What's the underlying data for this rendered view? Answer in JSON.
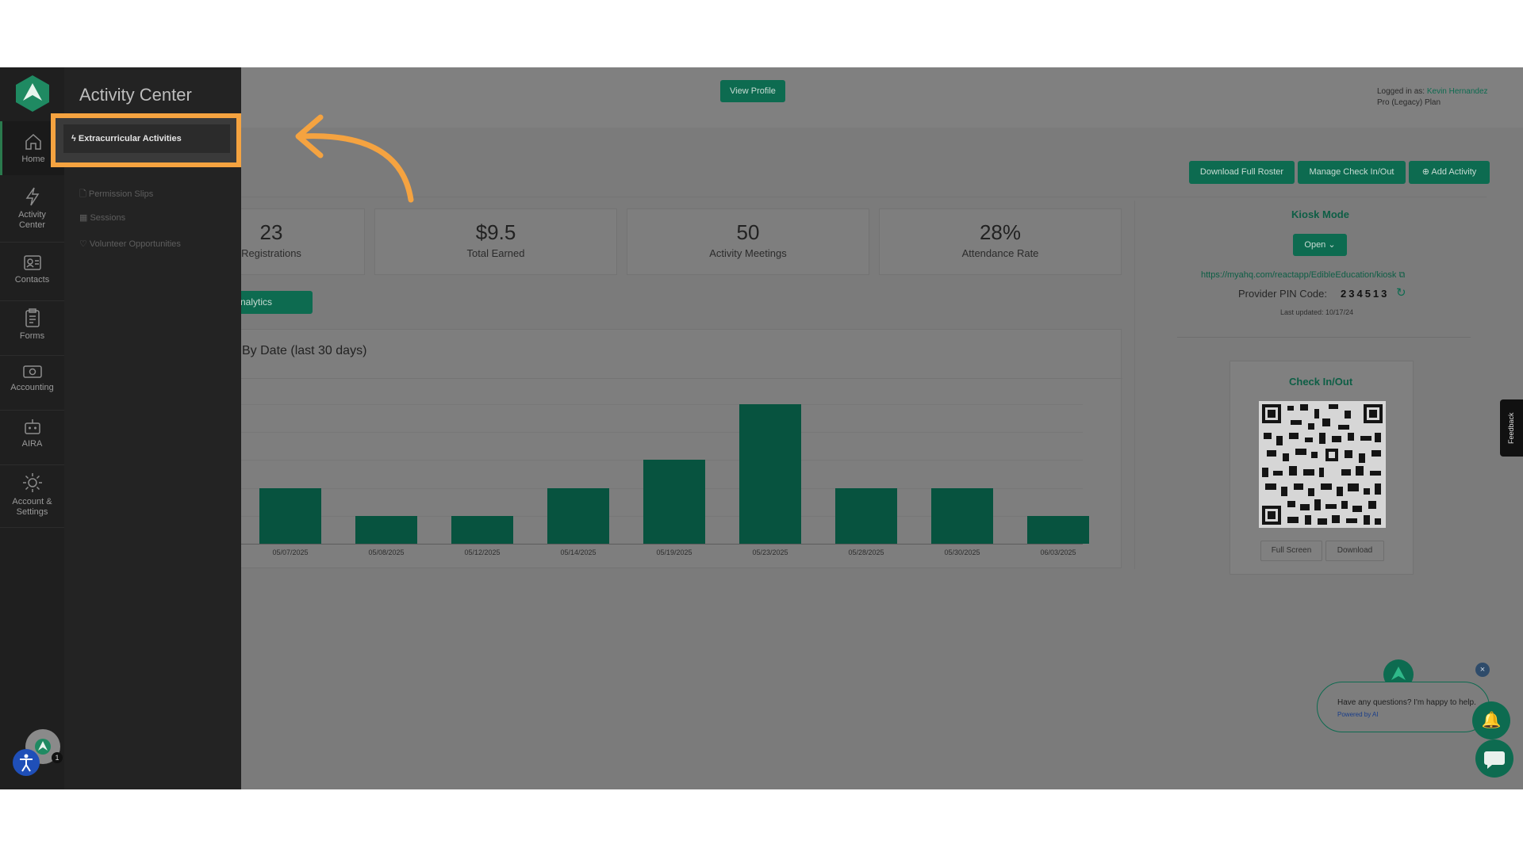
{
  "nav": {
    "items": [
      {
        "label": "Home",
        "icon": "home-icon"
      },
      {
        "label": "Activity Center",
        "icon": "lightning-icon"
      },
      {
        "label": "Contacts",
        "icon": "contacts-icon"
      },
      {
        "label": "Forms",
        "icon": "clipboard-icon"
      },
      {
        "label": "Accounting",
        "icon": "cash-icon"
      },
      {
        "label": "AIRA",
        "icon": "robot-icon"
      },
      {
        "label": "Account & Settings",
        "icon": "gear-icon"
      }
    ],
    "notification_count": "1"
  },
  "panel": {
    "title": "Activity Center",
    "active_item": "Extracurricular Activities",
    "items": [
      "Permission Slips",
      "Sessions",
      "Volunteer Opportunities"
    ]
  },
  "header": {
    "view_profile": "View Profile",
    "logged_in_prefix": "Logged in as:",
    "user_name": "Kevin Hernandez",
    "plan": "Pro (Legacy) Plan"
  },
  "actions": {
    "download_roster": "Download Full Roster",
    "manage_checkin": "Manage Check In/Out",
    "add_activity": "Add Activity"
  },
  "stats": [
    {
      "value": "23",
      "label": "Registrations"
    },
    {
      "value": "$9.5",
      "label": "Total Earned"
    },
    {
      "value": "50",
      "label": "Activity Meetings"
    },
    {
      "value": "28%",
      "label": "Attendance Rate"
    }
  ],
  "analytics_button": "Analytics",
  "chart": {
    "title": "By Date (last 30 days)"
  },
  "chart_data": {
    "type": "bar",
    "title": "By Date (last 30 days)",
    "categories": [
      "05/07/2025",
      "05/08/2025",
      "05/12/2025",
      "05/14/2025",
      "05/19/2025",
      "05/23/2025",
      "05/28/2025",
      "05/30/2025",
      "06/03/2025"
    ],
    "values": [
      2,
      1,
      1,
      2,
      3,
      5,
      2,
      2,
      1
    ],
    "ylim": [
      0,
      5
    ],
    "xlabel": "",
    "ylabel": "",
    "grid": true,
    "color": "#07533f"
  },
  "kiosk": {
    "title": "Kiosk Mode",
    "open_button": "Open",
    "url": "https://myahq.com/reactapp/EdibleEducation/kiosk",
    "pin_label": "Provider PIN Code:",
    "pin": "234513",
    "last_updated": "Last updated: 10/17/24"
  },
  "checkin": {
    "title": "Check In/Out",
    "full_screen": "Full Screen",
    "download": "Download"
  },
  "feedback": "Feedback",
  "chat": {
    "question": "Have any questions? I'm happy to help.",
    "powered": "Powered by AI"
  },
  "colors": {
    "accent": "#0d6b50",
    "highlight": "#f5a340",
    "rail": "#1f1f1f",
    "overlay": "#7b7b7b"
  }
}
